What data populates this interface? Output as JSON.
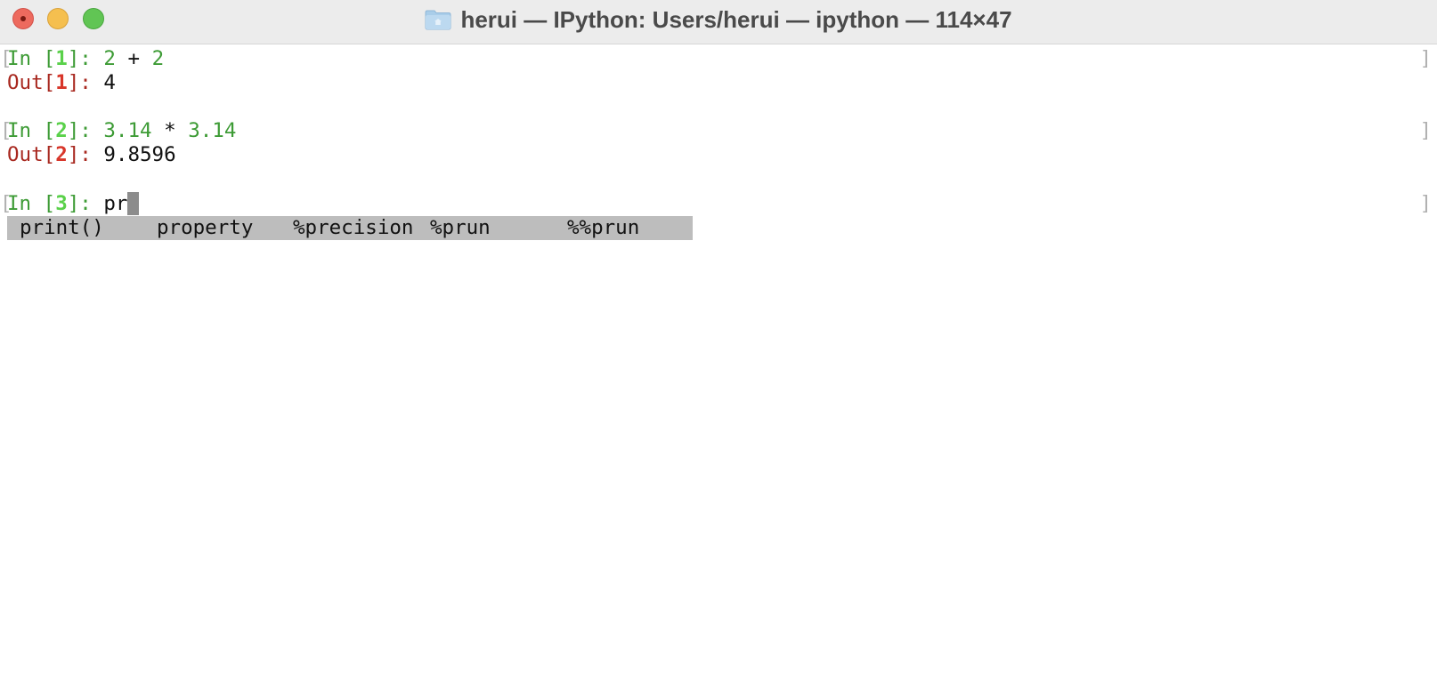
{
  "window": {
    "title": "herui — IPython: Users/herui — ipython — 114×47",
    "folder_icon": "folder-icon"
  },
  "session": [
    {
      "in_prefix": "In [",
      "in_num": "1",
      "in_suffix": "]: ",
      "code_a": "2",
      "code_op": " + ",
      "code_b": "2",
      "out_prefix": "Out[",
      "out_num": "1",
      "out_suffix": "]: ",
      "out_value": "4"
    },
    {
      "in_prefix": "In [",
      "in_num": "2",
      "in_suffix": "]: ",
      "code_a": "3.14",
      "code_op": " * ",
      "code_b": "3.14",
      "out_prefix": "Out[",
      "out_num": "2",
      "out_suffix": "]: ",
      "out_value": "9.8596"
    }
  ],
  "current_input": {
    "in_prefix": "In [",
    "in_num": "3",
    "in_suffix": "]: ",
    "typed": "pr"
  },
  "completions": [
    "print()",
    "property",
    "%precision",
    "%prun",
    "%%prun"
  ],
  "colors": {
    "prompt_in": "#3d9b35",
    "prompt_in_num": "#5ad14a",
    "prompt_out": "#a8281f",
    "prompt_out_num": "#d8362a",
    "completion_bg": "#bdbdbd"
  }
}
